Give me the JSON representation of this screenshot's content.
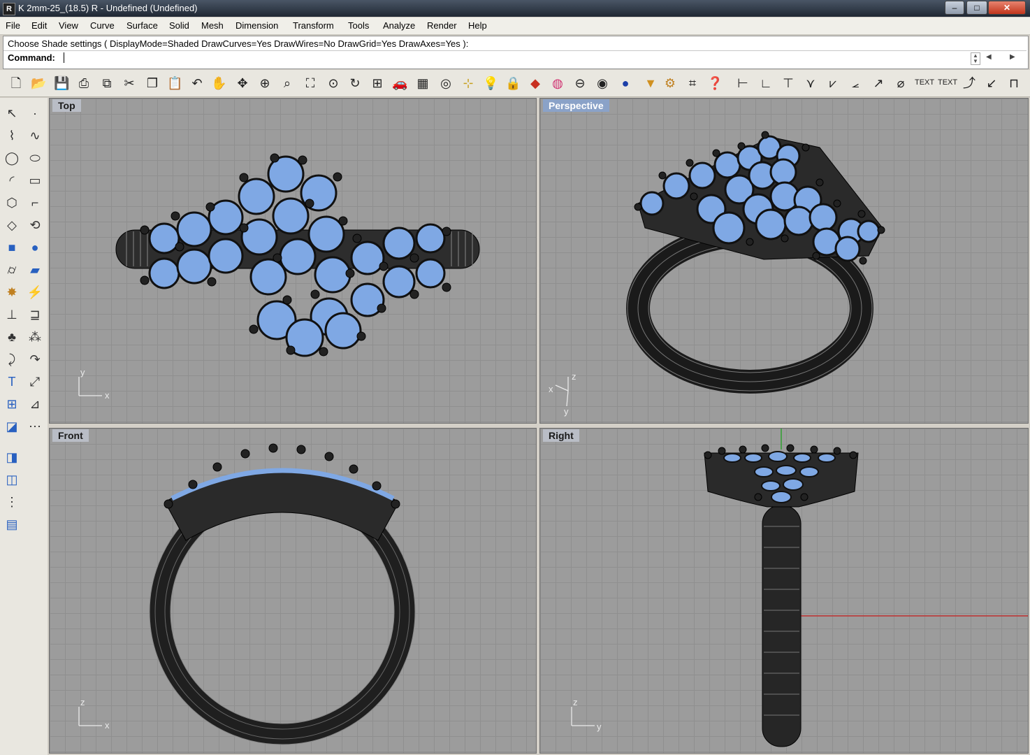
{
  "window": {
    "title": "K 2mm-25_(18.5) R - Undefined (Undefined)",
    "min": "–",
    "max": "□",
    "close": "✕"
  },
  "menu": [
    "File",
    "Edit",
    "View",
    "Curve",
    "Surface",
    "Solid",
    "Mesh",
    "Dimension",
    "Transform",
    "Tools",
    "Analyze",
    "Render",
    "Help"
  ],
  "command": {
    "history": "Choose Shade settings ( DisplayMode=Shaded  DrawCurves=Yes  DrawWires=No  DrawGrid=Yes  DrawAxes=Yes ):",
    "prompt": "Command:",
    "value": ""
  },
  "toolbar": {
    "icons": [
      "new-icon",
      "open-icon",
      "save-icon",
      "print-icon",
      "import-icon",
      "cut-icon",
      "copy-icon",
      "paste-icon",
      "undo-icon",
      "pan-icon",
      "move-view-icon",
      "zoom-in-icon",
      "zoom-window-icon",
      "zoom-extents-icon",
      "zoom-selected-icon",
      "rotate-view-icon",
      "four-view-icon",
      "car-icon",
      "grid-icon",
      "osnap-icon",
      "snap-icon",
      "light-icon",
      "lock-icon",
      "layer-icon",
      "color-wheel-icon",
      "sphere-wire-icon",
      "sphere-mesh-icon",
      "sphere-render-icon",
      "pointer-filter-icon",
      "settings-icon",
      "dimension-icon",
      "help-icon",
      "dim-horizontal-icon",
      "dim-aligned-icon",
      "dim-ordinate-icon",
      "dim-angle-icon",
      "dim-angle2-icon",
      "dim-arc-icon",
      "dim-radius-icon",
      "dim-diameter-icon"
    ],
    "text_1": "TEXT",
    "text_2": "TEXT"
  },
  "viewports": {
    "top": {
      "label": "Top",
      "axis_a": "x",
      "axis_b": "y"
    },
    "perspective": {
      "label": "Perspective",
      "axis_a": "x",
      "axis_b": "z",
      "axis_c": "y"
    },
    "front": {
      "label": "Front",
      "axis_a": "x",
      "axis_b": "z"
    },
    "right": {
      "label": "Right",
      "axis_a": "y",
      "axis_b": "z"
    }
  },
  "colors": {
    "stone": "#7fa8e4",
    "metal": "#2e2e2e",
    "grid": "#9c9c9c",
    "x_axis": "#c03030",
    "y_axis": "#30a030"
  }
}
